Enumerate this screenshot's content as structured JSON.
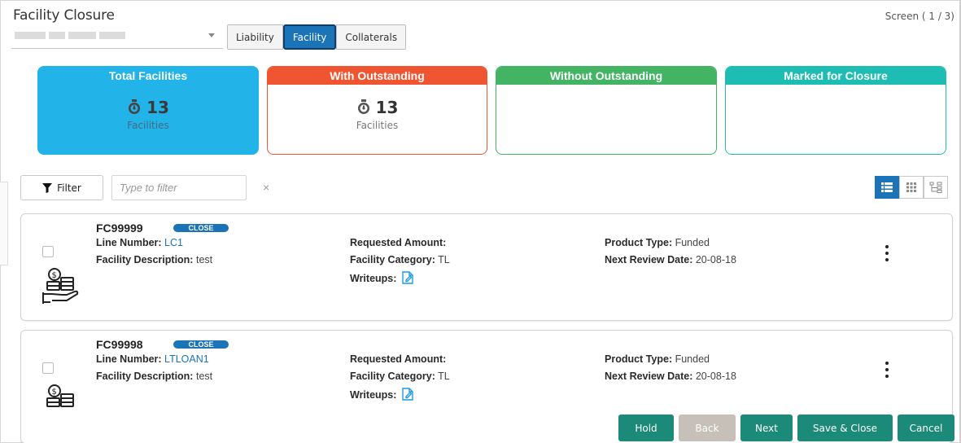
{
  "page": {
    "title": "Facility Closure",
    "screen_indicator": "Screen ( 1 / 3)"
  },
  "tabs": [
    {
      "label": "Liability",
      "active": false
    },
    {
      "label": "Facility",
      "active": true
    },
    {
      "label": "Collaterals",
      "active": false
    }
  ],
  "summary_cards": {
    "total": {
      "title": "Total Facilities",
      "count": "13",
      "unit": "Facilities",
      "color": "#22b3e8"
    },
    "with_outstanding": {
      "title": "With Outstanding",
      "count": "13",
      "unit": "Facilities",
      "color": "#ef5530"
    },
    "without_outstanding": {
      "title": "Without Outstanding",
      "color": "#43b464"
    },
    "marked_for_closure": {
      "title": "Marked for Closure",
      "color": "#1ebdb3"
    }
  },
  "filter": {
    "button_label": "Filter",
    "placeholder": "Type to filter",
    "clear_symbol": "×"
  },
  "facilities": [
    {
      "id": "FC99999",
      "status": "CLOSE",
      "line_number_label": "Line Number:",
      "line_number": "LC1",
      "description_label": "Facility Description:",
      "description": "test",
      "requested_amount_label": "Requested Amount:",
      "requested_amount": "",
      "category_label": "Facility Category:",
      "category": "TL",
      "writeups_label": "Writeups:",
      "product_type_label": "Product Type:",
      "product_type": "Funded",
      "next_review_label": "Next Review Date:",
      "next_review": "20-08-18"
    },
    {
      "id": "FC99998",
      "status": "CLOSE",
      "line_number_label": "Line Number:",
      "line_number": "LTLOAN1",
      "description_label": "Facility Description:",
      "description": "test",
      "requested_amount_label": "Requested Amount:",
      "requested_amount": "",
      "category_label": "Facility Category:",
      "category": "TL",
      "writeups_label": "Writeups:",
      "product_type_label": "Product Type:",
      "product_type": "Funded",
      "next_review_label": "Next Review Date:",
      "next_review": "20-08-18"
    }
  ],
  "footer": {
    "hold": "Hold",
    "back": "Back",
    "next": "Next",
    "save_close": "Save & Close",
    "cancel": "Cancel"
  },
  "colors": {
    "accent": "#1c74b8",
    "action": "#1b8a78",
    "disabled": "#c7c0b8"
  }
}
